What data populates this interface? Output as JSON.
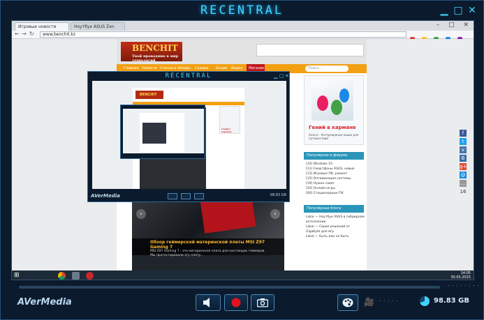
{
  "app": {
    "title": "RECENTRAL",
    "brand": "AVerMedia",
    "storage": "98.83 GB",
    "time_readout": "- - : - - : - -",
    "camera_status": "- - : - -",
    "colors": {
      "accent": "#3fd4ff",
      "record": "#e0131e",
      "frame": "#0b1a2c"
    }
  },
  "browser": {
    "tabs": [
      {
        "label": "Игровые новости"
      },
      {
        "label": "Ноутбук ASUS Zen"
      }
    ],
    "address": "www.benchit.kz"
  },
  "site": {
    "logo": "BENCHIT",
    "tagline": "Твой проводник в мир технологий",
    "nav": [
      "Главная",
      "Новости",
      "Статьи и обзоры",
      "Скидки",
      "Акции",
      "Видео",
      "Магазин"
    ],
    "search_placeholder": "Поиск...",
    "slide": {
      "title": "Обзор геймерской материнской платы MSI Z97 Gaming 7",
      "text": "MSI Z97 Gaming 7 - это материнская плата для настоящих геймеров. Мы протестировали эту плату..."
    },
    "ad": {
      "title": "Гений в кармане",
      "subtitle": "Genius - беспроводные мыши для путешествий"
    },
    "sidebar_heads": [
      "Популярное в форуме",
      "Популярные блоги"
    ],
    "forum_items": [
      "[10] Windows 10",
      "[11] Смартфоны ASUS, новые",
      "[13] Игровые ПК, ремонт",
      "[15] Оптимизация системы",
      "[19] Нужен совет",
      "[20] Онлайн-игры",
      "[60] Стационарные ПК"
    ],
    "blog_items": [
      "Lakai — Ноутбук ASUS в гибридном исполнении",
      "Lakai — Серия решений от Gigabyte для игр",
      "Lakai — Быть или не быть"
    ]
  },
  "right_edge_letters": [
    "К",
    "US",
    "к",
    "ы",
    "к",
    "ы",
    "к",
    "к"
  ],
  "social": [
    "f",
    "t",
    "v",
    "B",
    "g+",
    "@",
    "...",
    "16"
  ],
  "taskbar": {
    "clock": "14:05",
    "date": "30.05.2015"
  },
  "inner": {
    "title": "RECENTRAL",
    "brand": "AVerMedia",
    "storage": "98.83 GB"
  }
}
